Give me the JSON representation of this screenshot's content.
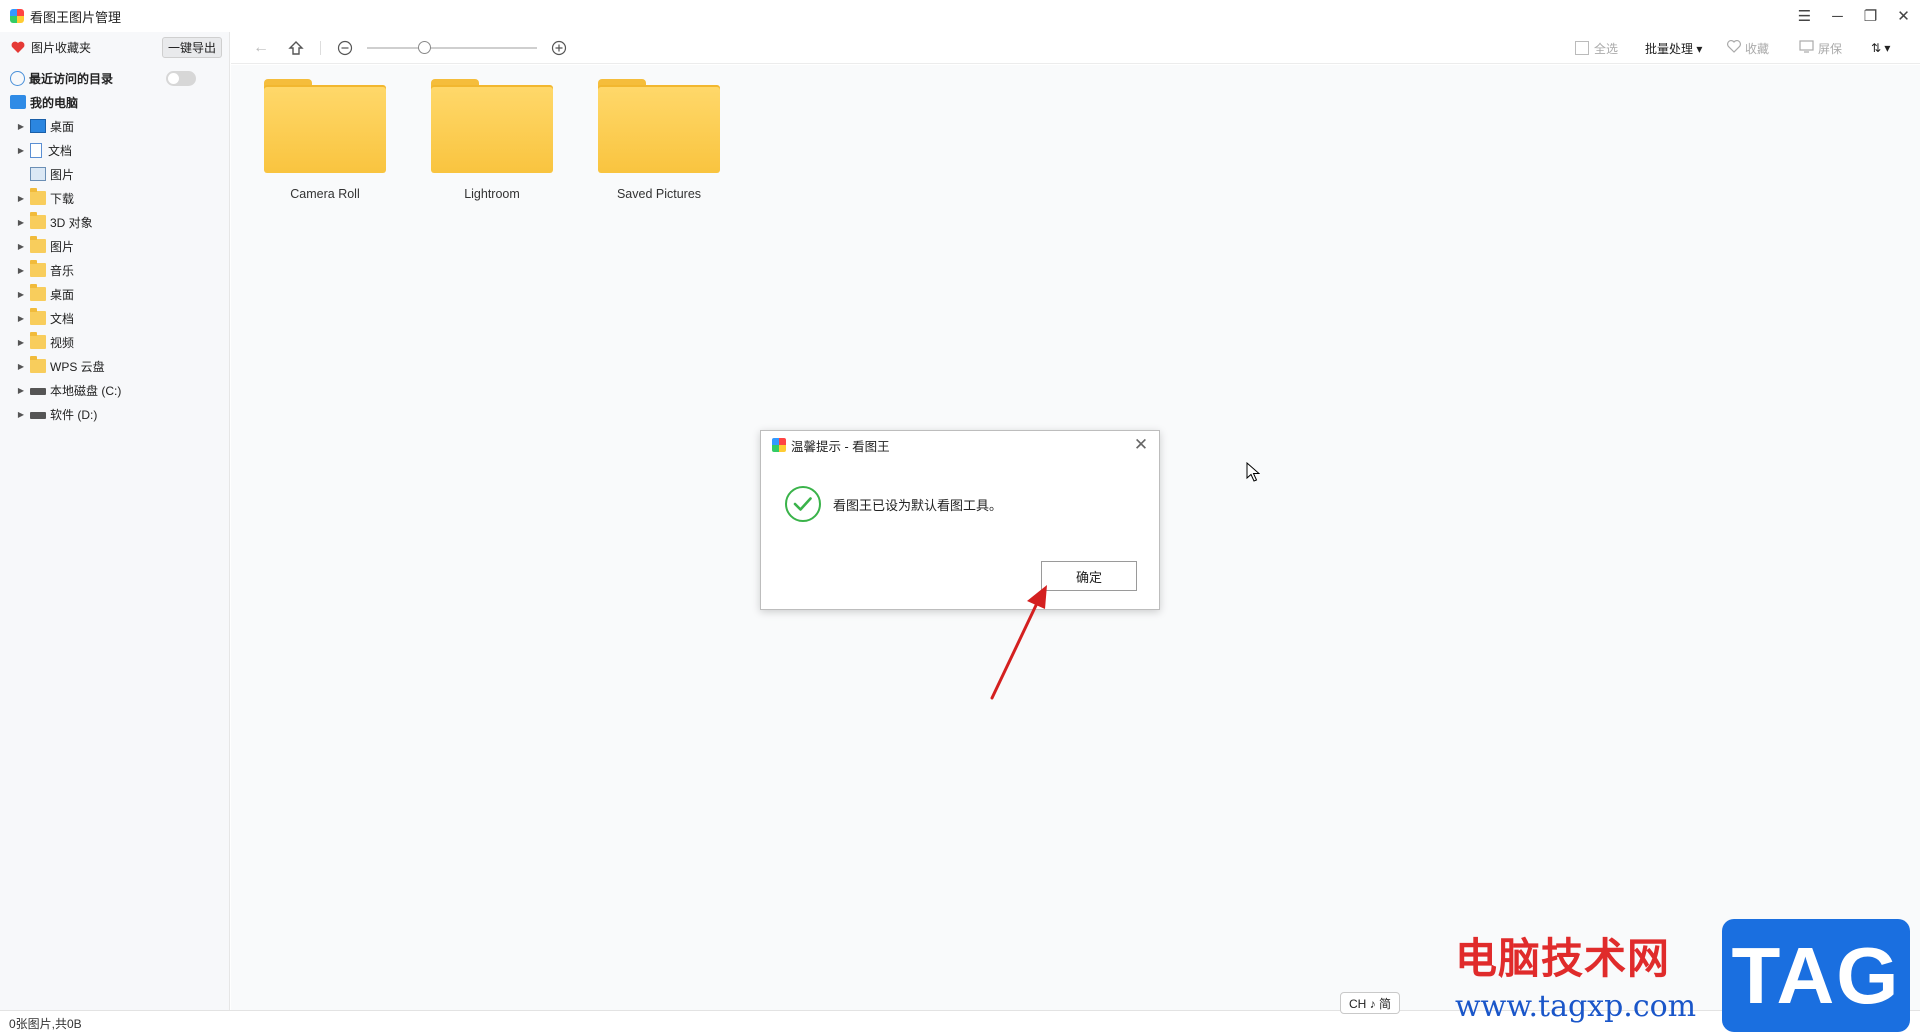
{
  "app": {
    "title": "看图王图片管理",
    "window_buttons": [
      "☰",
      "─",
      "❐",
      "✕"
    ]
  },
  "sidebar": {
    "favorites_label": "图片收藏夹",
    "export_button": "一键导出",
    "recent_label": "最近访问的目录",
    "my_computer_label": "我的电脑",
    "items": [
      {
        "label": "桌面",
        "icon": "desktop-icon",
        "expandable": true
      },
      {
        "label": "文档",
        "icon": "document-icon",
        "expandable": true
      },
      {
        "label": "图片",
        "icon": "picture-icon",
        "expandable": false
      },
      {
        "label": "下载",
        "icon": "folder-icon",
        "expandable": true
      },
      {
        "label": "3D 对象",
        "icon": "folder-icon",
        "expandable": true
      },
      {
        "label": "图片",
        "icon": "folder-icon",
        "expandable": true
      },
      {
        "label": "音乐",
        "icon": "folder-icon",
        "expandable": true
      },
      {
        "label": "桌面",
        "icon": "folder-icon",
        "expandable": true
      },
      {
        "label": "文档",
        "icon": "folder-icon",
        "expandable": true
      },
      {
        "label": "视频",
        "icon": "folder-icon",
        "expandable": true
      },
      {
        "label": "WPS 云盘",
        "icon": "folder-icon",
        "expandable": true
      },
      {
        "label": "本地磁盘 (C:)",
        "icon": "drive-icon",
        "expandable": true
      },
      {
        "label": "软件 (D:)",
        "icon": "drive-icon",
        "expandable": true
      }
    ]
  },
  "toolbar": {
    "select_all": "全选",
    "batch": "批量处理 ▾",
    "favorite": "收藏",
    "screensaver": "屏保",
    "sort": "⇅ ▾"
  },
  "folders": [
    {
      "name": "Camera Roll"
    },
    {
      "name": "Lightroom"
    },
    {
      "name": "Saved Pictures"
    }
  ],
  "status": {
    "text": "0张图片,共0B"
  },
  "dialog": {
    "title": "温馨提示 - 看图王",
    "message": "看图王已设为默认看图工具。",
    "ok_button": "确定"
  },
  "ime": {
    "text": "CH ♪ 简"
  },
  "watermark": {
    "cn": "电脑技术网",
    "url": "www.tagxp.com",
    "tag": "TAG"
  },
  "colors": {
    "accent_check": "#3ab34a",
    "annotation_arrow": "#d42020",
    "heart": "#e53935"
  }
}
